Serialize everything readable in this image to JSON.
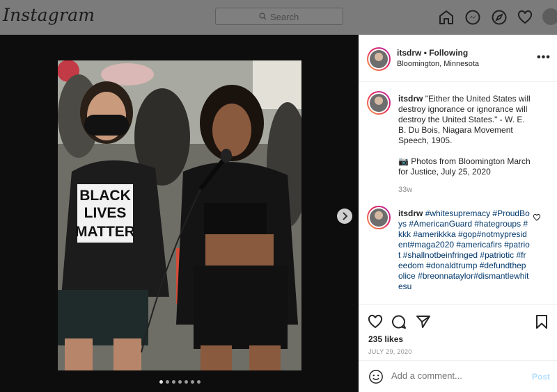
{
  "app": {
    "logo": "Instagram"
  },
  "search": {
    "placeholder": "Search"
  },
  "nav": [
    "home-icon",
    "messenger-icon",
    "explore-icon",
    "activity-heart-icon",
    "profile-avatar"
  ],
  "post": {
    "username": "itsdrw",
    "follow_label": "• Following",
    "location": "Bloomington, Minnesota",
    "more": "•••",
    "caption_text": "\"Either the United States will destroy ignorance or ignorance will destroy the United States.\" - W. E. B. Du Bois, Niagara Movement Speech, 1905.",
    "caption_photos": "📷 Photos from Bloomington March for Justice, July 25, 2020",
    "caption_age": "33w",
    "comment_username": "itsdrw",
    "comment_text": "#whitesupremacy #ProudBoys #AmericanGuard #hategroups #kkk #amerikkka #gop#notmypresident#maga2020 #americafirs #patriot #shallnotbeinfringed #patriotic #freedom #donaldtrump #defundthepolice #breonnataylor#dismantlewhitesu",
    "likes": "235 likes",
    "date": "JULY 29, 2020",
    "add_comment_placeholder": "Add a comment...",
    "post_label": "Post",
    "photo_sign": "BLACK LIVES MATTER",
    "carousel": {
      "count": 7,
      "active_index": 0
    }
  }
}
